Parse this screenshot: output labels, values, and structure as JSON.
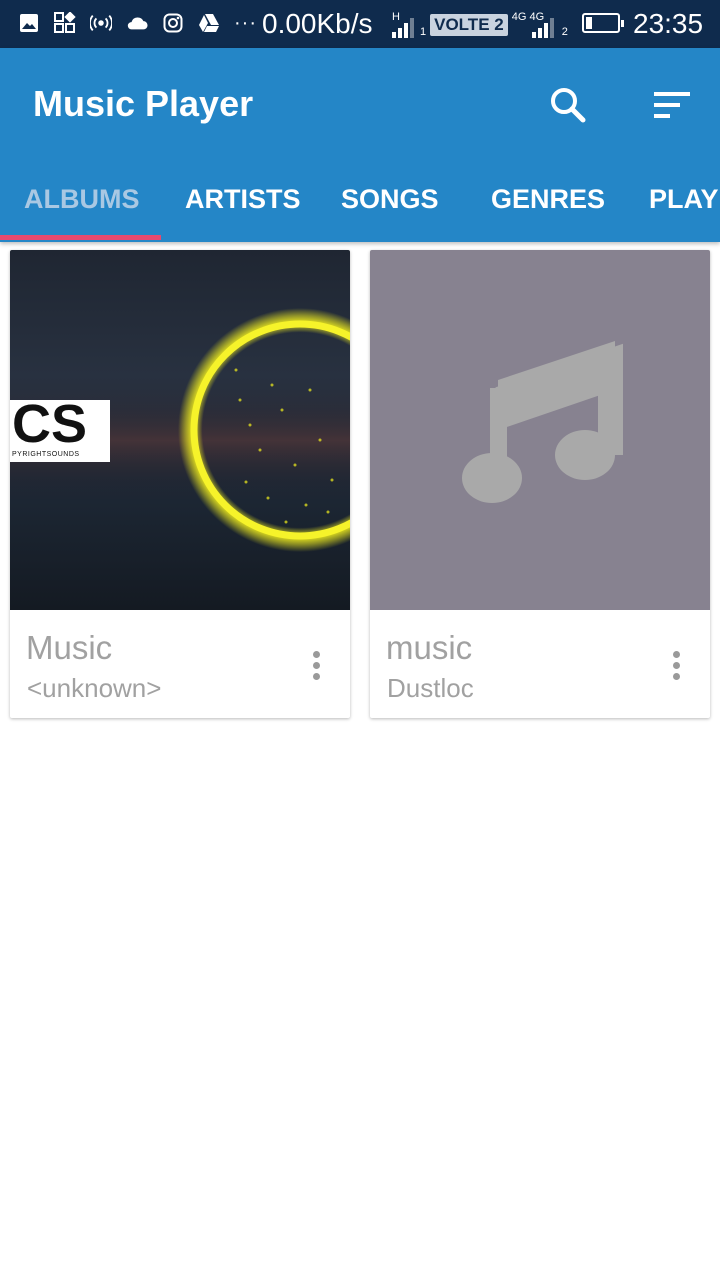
{
  "status_bar": {
    "icons": [
      "image-icon",
      "apps-icon",
      "hotspot-icon",
      "cloud-icon",
      "instagram-icon",
      "drive-icon"
    ],
    "more": "···",
    "net_speed": "0.00Kb/s",
    "sim1_label": "H",
    "sim1_index": "1",
    "volte": "VOLTE 2",
    "sim2_label": "4G 4G",
    "sim2_index": "2",
    "battery_level": 0.2,
    "time": "23:35"
  },
  "app_bar": {
    "title": "Music Player",
    "actions": [
      "search-icon",
      "sort-icon"
    ]
  },
  "tabs": [
    {
      "label": "ALBUMS",
      "active": true
    },
    {
      "label": "ARTISTS",
      "active": false
    },
    {
      "label": "SONGS",
      "active": false
    },
    {
      "label": "GENRES",
      "active": false
    },
    {
      "label": "PLAYLISTS",
      "active": false
    }
  ],
  "albums": [
    {
      "title": "Music",
      "artist": "<unknown>",
      "art_text": "CS",
      "art_subtext": "PYRIGHTSOUNDS"
    },
    {
      "title": "music",
      "artist": "Dustloc",
      "art": "music-note-placeholder"
    }
  ],
  "colors": {
    "status_bar": "#0f2b4d",
    "app_bar": "#2486c7",
    "tab_indicator": "#e64a6f",
    "placeholder_art": "#878290",
    "ring_yellow": "#f3f01c"
  }
}
